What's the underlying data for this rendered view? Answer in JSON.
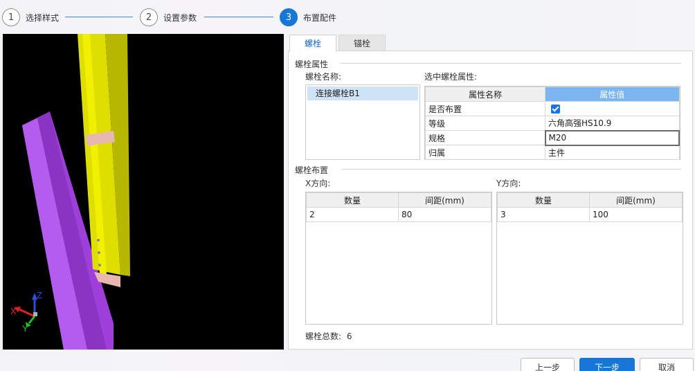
{
  "steps": [
    {
      "number": "1",
      "label": "选择样式",
      "state": "done"
    },
    {
      "number": "2",
      "label": "设置参数",
      "state": "done"
    },
    {
      "number": "3",
      "label": "布置配件",
      "state": "active"
    }
  ],
  "viewer": {
    "axis_labels": {
      "x": "X",
      "y": "Y",
      "z": "Z"
    },
    "colors": {
      "column": "#e7e600",
      "beam": "#a84ce6",
      "plate": "#e8b8b0",
      "background": "#000000"
    }
  },
  "tabs": [
    {
      "label": "螺栓",
      "active": true
    },
    {
      "label": "锚栓",
      "active": false
    }
  ],
  "bolt_properties": {
    "section_title": "螺栓属性",
    "name_label": "螺栓名称:",
    "selected_label": "选中螺栓属性:",
    "bolt_names": [
      "连接螺栓B1"
    ],
    "columns": [
      "属性名称",
      "属性值"
    ],
    "rows": [
      {
        "name": "是否布置",
        "value": "",
        "checked": true
      },
      {
        "name": "等级",
        "value": "六角高强HS10.9"
      },
      {
        "name": "规格",
        "value": "M20"
      },
      {
        "name": "归属",
        "value": "主件"
      }
    ]
  },
  "bolt_layout": {
    "section_title": "螺栓布置",
    "x_label": "X方向:",
    "y_label": "Y方向:",
    "x_columns": [
      "数量",
      "间距(mm)"
    ],
    "x_rows": [
      [
        "2",
        "80"
      ]
    ],
    "y_columns": [
      "数量",
      "间距(mm)"
    ],
    "y_rows": [
      [
        "3",
        "100"
      ]
    ],
    "total_label": "螺栓总数:",
    "total_value": "6"
  },
  "buttons": {
    "prev": "上一步",
    "next": "下一步",
    "cancel": "取消"
  },
  "accent_color": "#1677d9"
}
